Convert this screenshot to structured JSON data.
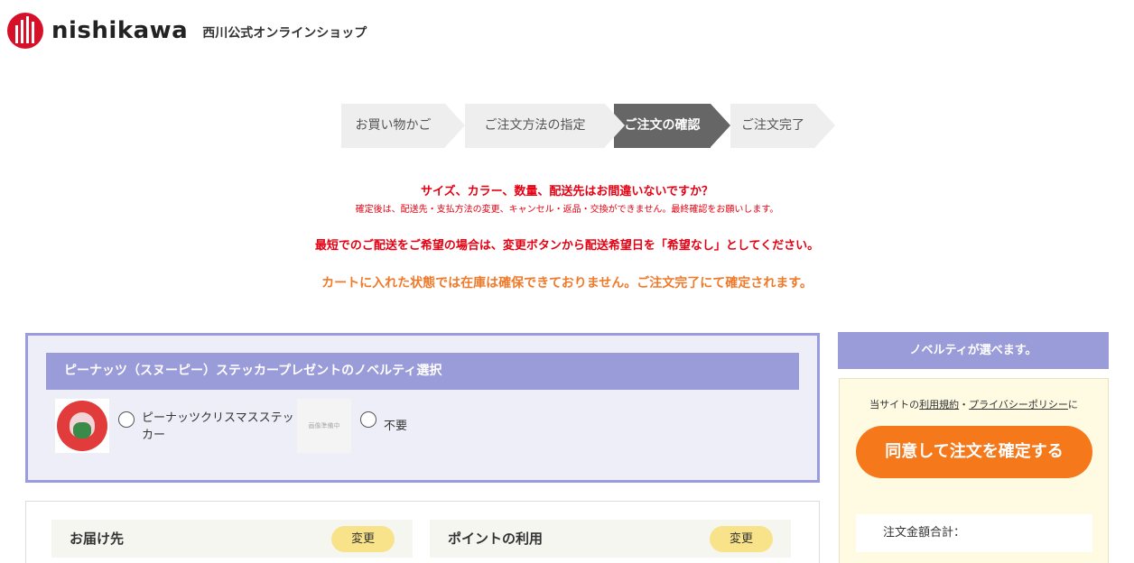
{
  "header": {
    "brand": "nishikawa",
    "shop_name": "西川公式オンラインショップ"
  },
  "steps": [
    {
      "label": "お買い物かご",
      "active": false
    },
    {
      "label": "ご注文方法の指定",
      "active": false
    },
    {
      "label": "ご注文の確認",
      "active": true
    },
    {
      "label": "ご注文完了",
      "active": false
    }
  ],
  "notices": {
    "check": "サイズ、カラー、数量、配送先はお間違いないですか？",
    "after_confirm": "確定後は、配送先・支払方法の変更、キャンセル・返品・交換ができません。最終確認をお願いします。",
    "fastest": "最短でのご配送をご希望の場合は、変更ボタンから配送希望日を「希望なし」としてください。",
    "stock": "カートに入れた状態では在庫は確保できておりません。ご注文完了にて確定されます。"
  },
  "novelty": {
    "heading": "ピーナッツ（スヌーピー）ステッカープレゼントのノベルティ選択",
    "options": [
      {
        "label": "ピーナッツクリスマスステッカー"
      },
      {
        "label": "不要",
        "placeholder_text": "画像準備中"
      }
    ]
  },
  "sections": {
    "delivery": {
      "title": "お届け先",
      "change_label": "変更"
    },
    "points": {
      "title": "ポイントの利用",
      "change_label": "変更"
    }
  },
  "sidebar": {
    "novelty_heading": "ノベルティが選べます。",
    "terms_prefix": "当サイトの",
    "terms_link": "利用規約",
    "terms_sep": "・",
    "privacy_link": "プライバシーポリシー",
    "terms_suffix": "に",
    "confirm_button": "同意して注文を確定する",
    "total_label": "注文金額合計："
  },
  "colors": {
    "brand_red": "#d7102a",
    "notice_red": "#e60012",
    "notice_orange": "#f07a2a",
    "novelty_purple": "#9a9bd9",
    "confirm_orange": "#f5781a",
    "change_yellow": "#f8e38a"
  }
}
